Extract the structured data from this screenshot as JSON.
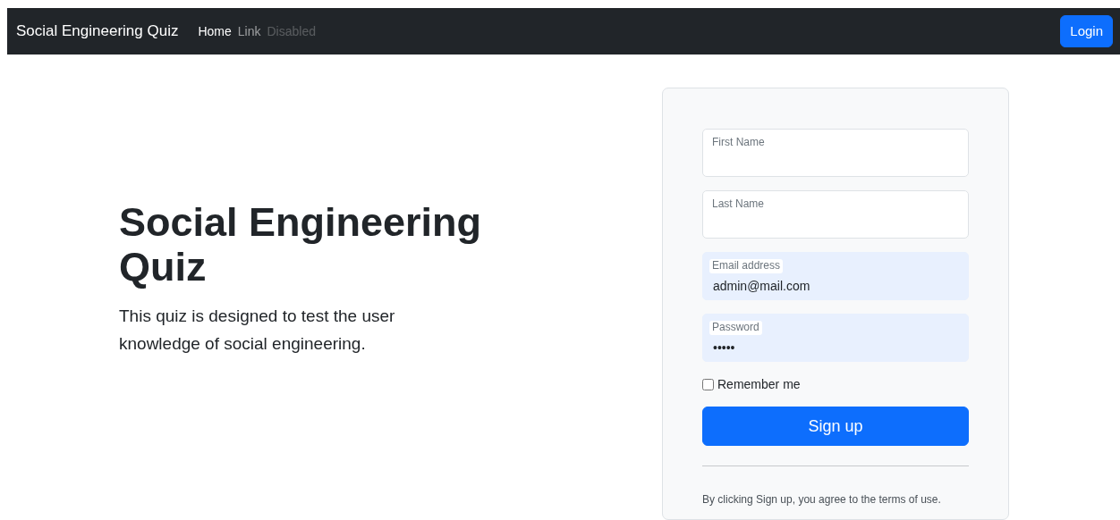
{
  "navbar": {
    "brand": "Social Engineering Quiz",
    "links": [
      {
        "label": "Home",
        "selected": true,
        "disabled": false
      },
      {
        "label": "Link",
        "selected": false,
        "disabled": false
      },
      {
        "label": "Disabled",
        "selected": false,
        "disabled": true
      }
    ],
    "login_button": "Login"
  },
  "hero": {
    "title": "Social Engineering Quiz",
    "text": "This quiz is designed to test the user knowledge of social engineering."
  },
  "form": {
    "fields": [
      {
        "label": "First Name",
        "autofilled": false
      },
      {
        "label": "Last Name",
        "autofilled": false
      },
      {
        "label": "Email address",
        "value": "admin@mail.com",
        "autofilled": true
      },
      {
        "label": "Password",
        "value": "•••••",
        "autofilled": true
      }
    ],
    "remember": {
      "label": "Remember me",
      "checked": false
    },
    "submit": "Sign up",
    "terms": "By clicking Sign up, you agree to the terms of use."
  }
}
